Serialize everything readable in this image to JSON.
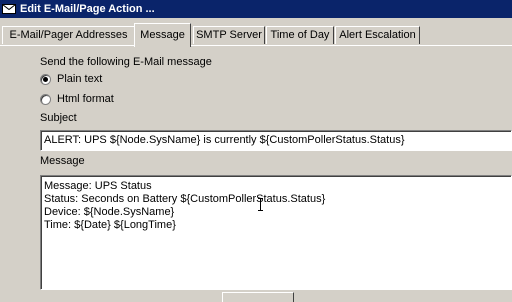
{
  "window": {
    "title": "Edit E-Mail/Page Action ..."
  },
  "tabs": [
    {
      "label": "E-Mail/Pager Addresses",
      "active": false
    },
    {
      "label": "Message",
      "active": true
    },
    {
      "label": "SMTP Server",
      "active": false
    },
    {
      "label": "Time of Day",
      "active": false
    },
    {
      "label": "Alert Escalation",
      "active": false
    }
  ],
  "message_tab": {
    "send_label": "Send the following E-Mail message",
    "format_options": [
      {
        "label": "Plain text",
        "selected": true
      },
      {
        "label": "Html format",
        "selected": false
      }
    ],
    "subject_label": "Subject",
    "subject_value": "ALERT: UPS ${Node.SysName} is currently ${CustomPollerStatus.Status}",
    "message_label": "Message",
    "message_lines": [
      "Message: UPS Status",
      "Status: Seconds on Battery  ${CustomPollerStatus.Status}",
      "Device: ${Node.SysName}",
      "Time: ${Date} ${LongTime}"
    ]
  },
  "colors": {
    "titlebar": "#0a246a",
    "face": "#d4d0c8"
  }
}
